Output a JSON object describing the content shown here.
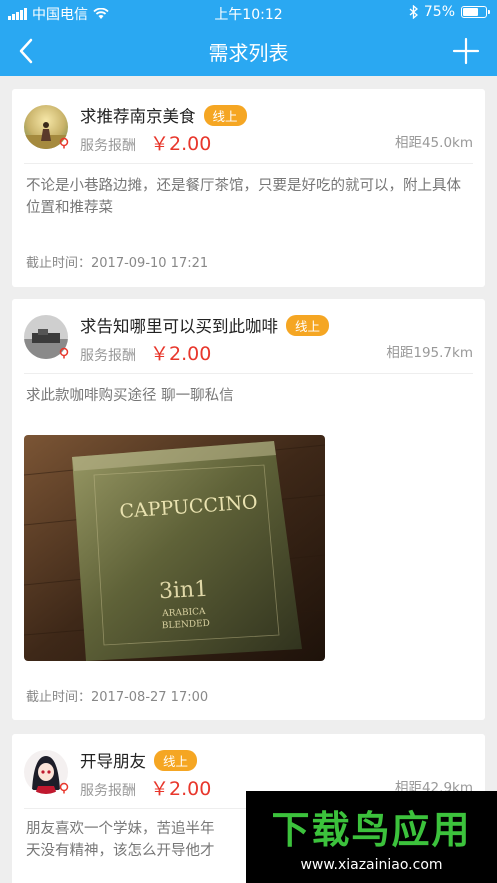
{
  "status_bar": {
    "carrier": "中国电信",
    "time": "上午10:12",
    "battery": "75%",
    "battery_level": 0.75
  },
  "nav": {
    "title": "需求列表"
  },
  "requests": [
    {
      "title": "求推荐南京美食",
      "badge": "线上",
      "reward_label": "服务报酬",
      "price": "￥2.00",
      "distance": "相距45.0km",
      "description": "不论是小巷路边摊，还是餐厅茶馆，只要是好吃的就可以，附上具体位置和推荐菜",
      "deadline": "截止时间：2017-09-10 17:21"
    },
    {
      "title": "求告知哪里可以买到此咖啡",
      "badge": "线上",
      "reward_label": "服务报酬",
      "price": "￥2.00",
      "distance": "相距195.7km",
      "description": "求此款咖啡购买途径  聊一聊私信",
      "photo_text": {
        "brand": "CAPPUCCINO",
        "big": "3in1",
        "sub1": "ARABICA",
        "sub2": "BLENDED"
      },
      "deadline": "截止时间：2017-08-27 17:00"
    },
    {
      "title": "开导朋友",
      "badge": "线上",
      "reward_label": "服务报酬",
      "price": "￥2.00",
      "distance": "相距42.9km",
      "description": "朋友喜欢一个学妹，苦追半年\n天没有精神，该怎么开导他才"
    }
  ],
  "watermark": {
    "title": "下载鸟应用",
    "url": "www.xiazainiao.com"
  },
  "colors": {
    "accent": "#2aa8f2",
    "price": "#e8372c",
    "badge": "#f5a623",
    "background": "#eeeeee"
  }
}
